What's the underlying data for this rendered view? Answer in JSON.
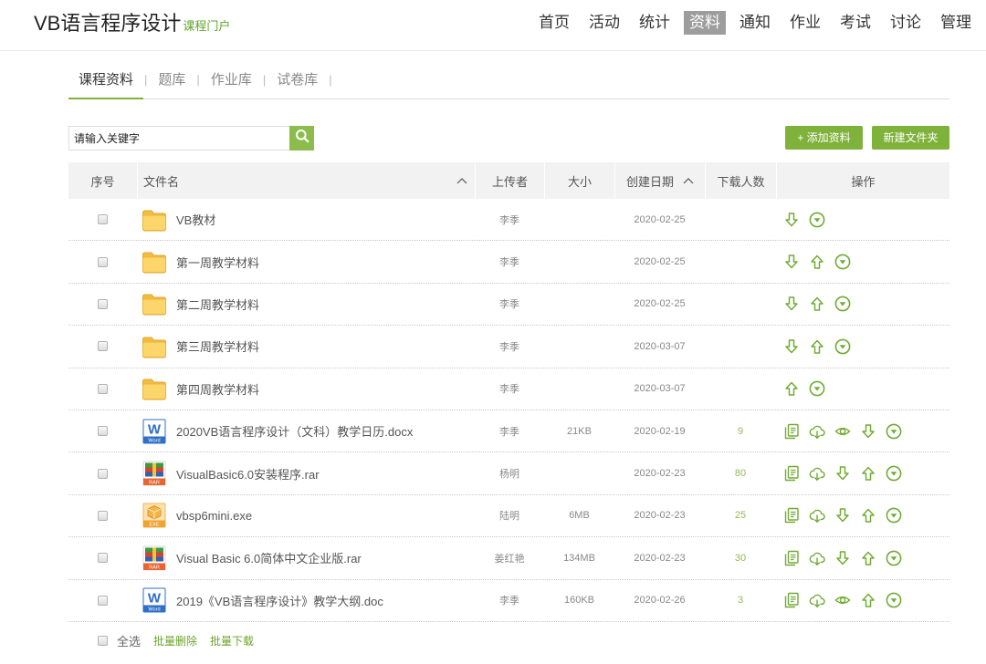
{
  "header": {
    "title": "VB语言程序设计",
    "subtitle": "课程门户",
    "nav": [
      {
        "label": "首页",
        "active": false
      },
      {
        "label": "活动",
        "active": false
      },
      {
        "label": "统计",
        "active": false
      },
      {
        "label": "资料",
        "active": true
      },
      {
        "label": "通知",
        "active": false
      },
      {
        "label": "作业",
        "active": false
      },
      {
        "label": "考试",
        "active": false
      },
      {
        "label": "讨论",
        "active": false
      },
      {
        "label": "管理",
        "active": false
      }
    ]
  },
  "subtabs": [
    {
      "label": "课程资料",
      "active": true
    },
    {
      "label": "题库",
      "active": false
    },
    {
      "label": "作业库",
      "active": false
    },
    {
      "label": "试卷库",
      "active": false
    }
  ],
  "subtab_separator": "|",
  "search": {
    "placeholder": "请输入关键字",
    "value": "",
    "button_icon": "search-icon"
  },
  "toolbar": {
    "add_label": "+ 添加资料",
    "new_folder_label": "新建文件夹"
  },
  "table": {
    "columns": {
      "index": "序号",
      "name": "文件名",
      "uploader": "上传者",
      "size": "大小",
      "created": "创建日期",
      "downloads": "下载人数",
      "actions": "操作"
    },
    "sort_icon": "chevron-up-icon",
    "rows": [
      {
        "icon": "folder",
        "name": "VB教材",
        "uploader": "李季",
        "size": "",
        "created": "2020-02-25",
        "downloads": "",
        "selected": false,
        "actions": [
          "arrow-down",
          "circle-chevron-down"
        ]
      },
      {
        "icon": "folder",
        "name": "第一周教学材料",
        "uploader": "李季",
        "size": "",
        "created": "2020-02-25",
        "downloads": "",
        "selected": false,
        "actions": [
          "arrow-down",
          "arrow-up",
          "circle-chevron-down"
        ]
      },
      {
        "icon": "folder",
        "name": "第二周教学材料",
        "uploader": "李季",
        "size": "",
        "created": "2020-02-25",
        "downloads": "",
        "selected": false,
        "actions": [
          "arrow-down",
          "arrow-up",
          "circle-chevron-down"
        ]
      },
      {
        "icon": "folder",
        "name": "第三周教学材料",
        "uploader": "李季",
        "size": "",
        "created": "2020-03-07",
        "downloads": "",
        "selected": false,
        "actions": [
          "arrow-down",
          "arrow-up",
          "circle-chevron-down"
        ]
      },
      {
        "icon": "folder",
        "name": "第四周教学材料",
        "uploader": "李季",
        "size": "",
        "created": "2020-03-07",
        "downloads": "",
        "selected": false,
        "actions": [
          "arrow-up",
          "circle-chevron-down"
        ]
      },
      {
        "icon": "word",
        "name": "2020VB语言程序设计（文科）教学日历.docx",
        "uploader": "李季",
        "size": "21KB",
        "created": "2020-02-19",
        "downloads": "9",
        "selected": false,
        "actions": [
          "document-preview",
          "cloud-download",
          "eye",
          "arrow-down",
          "circle-chevron-down"
        ]
      },
      {
        "icon": "rar",
        "name": "VisualBasic6.0安装程序.rar",
        "uploader": "杨明",
        "size": "",
        "created": "2020-02-23",
        "downloads": "80",
        "selected": false,
        "actions": [
          "document-preview",
          "cloud-download",
          "arrow-down",
          "arrow-up",
          "circle-chevron-down"
        ]
      },
      {
        "icon": "exe",
        "name": "vbsp6mini.exe",
        "uploader": "陆明",
        "size": "6MB",
        "created": "2020-02-23",
        "downloads": "25",
        "selected": false,
        "actions": [
          "document-preview",
          "cloud-download",
          "arrow-down",
          "arrow-up",
          "circle-chevron-down"
        ]
      },
      {
        "icon": "rar",
        "name": "Visual Basic 6.0简体中文企业版.rar",
        "uploader": "姜红艳",
        "size": "134MB",
        "created": "2020-02-23",
        "downloads": "30",
        "selected": false,
        "actions": [
          "document-preview",
          "cloud-download",
          "arrow-down",
          "arrow-up",
          "circle-chevron-down"
        ]
      },
      {
        "icon": "word",
        "name": "2019《VB语言程序设计》教学大纲.doc",
        "uploader": "李季",
        "size": "160KB",
        "created": "2020-02-26",
        "downloads": "3",
        "selected": false,
        "actions": [
          "document-preview",
          "cloud-download",
          "eye",
          "arrow-up",
          "circle-chevron-down"
        ]
      }
    ]
  },
  "file_icons": {
    "word": {
      "glyph": "W",
      "badge": "Word"
    },
    "rar": {
      "badge": "RAR"
    },
    "exe": {
      "badge": "EXE"
    }
  },
  "footer": {
    "select_all": "全选",
    "batch_delete": "批量删除",
    "batch_download": "批量下载"
  },
  "colors": {
    "accent": "#7fb23b",
    "accent_text": "#6aa52b",
    "search_button": "#8cbd4c",
    "icon": "#72ab35",
    "download_count": "#94b85a",
    "active_nav_bg": "#9d9d9d",
    "subtitle": "#5fa52e",
    "folder": "#fcd66a",
    "word": "#2f6fc6",
    "rar": "#e9652f",
    "exe": "#f5b445"
  }
}
